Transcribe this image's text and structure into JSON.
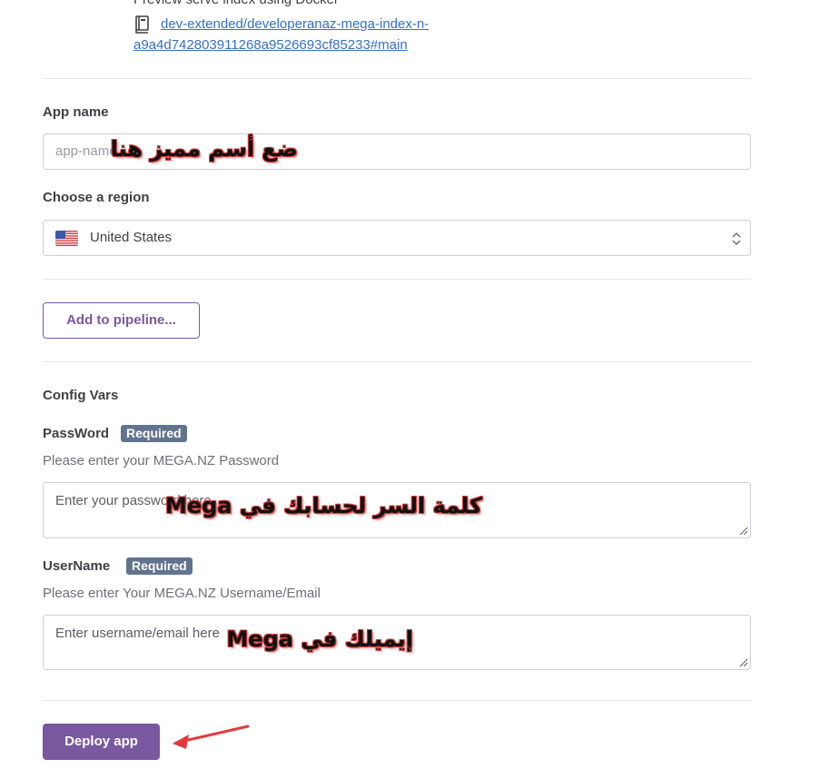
{
  "header": {
    "clipped_text": "Preview serve index using Docker",
    "repo_link": "dev-extended/developeranaz-mega-index-n-a9a4d742803911268a9526693cf85233#main",
    "repo_icon": "book-icon"
  },
  "app_name": {
    "label": "App name",
    "placeholder": "app-name",
    "annotation": "ضع أسم مميز هنا"
  },
  "region": {
    "label": "Choose a region",
    "value": "United States",
    "flag_icon": "us-flag-icon",
    "chevron_icon": "up-down-chevron-icon"
  },
  "pipeline": {
    "button_label": "Add to pipeline..."
  },
  "config": {
    "heading": "Config Vars",
    "password": {
      "label": "PassWord",
      "badge": "Required",
      "help": "Please enter your MEGA.NZ Password",
      "placeholder": "Enter your password here",
      "annotation": "كلمة السر لحسابك في Mega"
    },
    "username": {
      "label": "UserName",
      "badge": "Required",
      "help": "Please enter Your MEGA.NZ Username/Email",
      "placeholder": "Enter username/email here",
      "annotation": "إيميلك في Mega"
    }
  },
  "deploy": {
    "button_label": "Deploy app",
    "arrow_icon": "red-arrow-icon"
  },
  "colors": {
    "accent": "#79589f",
    "link": "#3570c5",
    "badge": "#62738d",
    "annotation_outline": "#d13b3b"
  }
}
